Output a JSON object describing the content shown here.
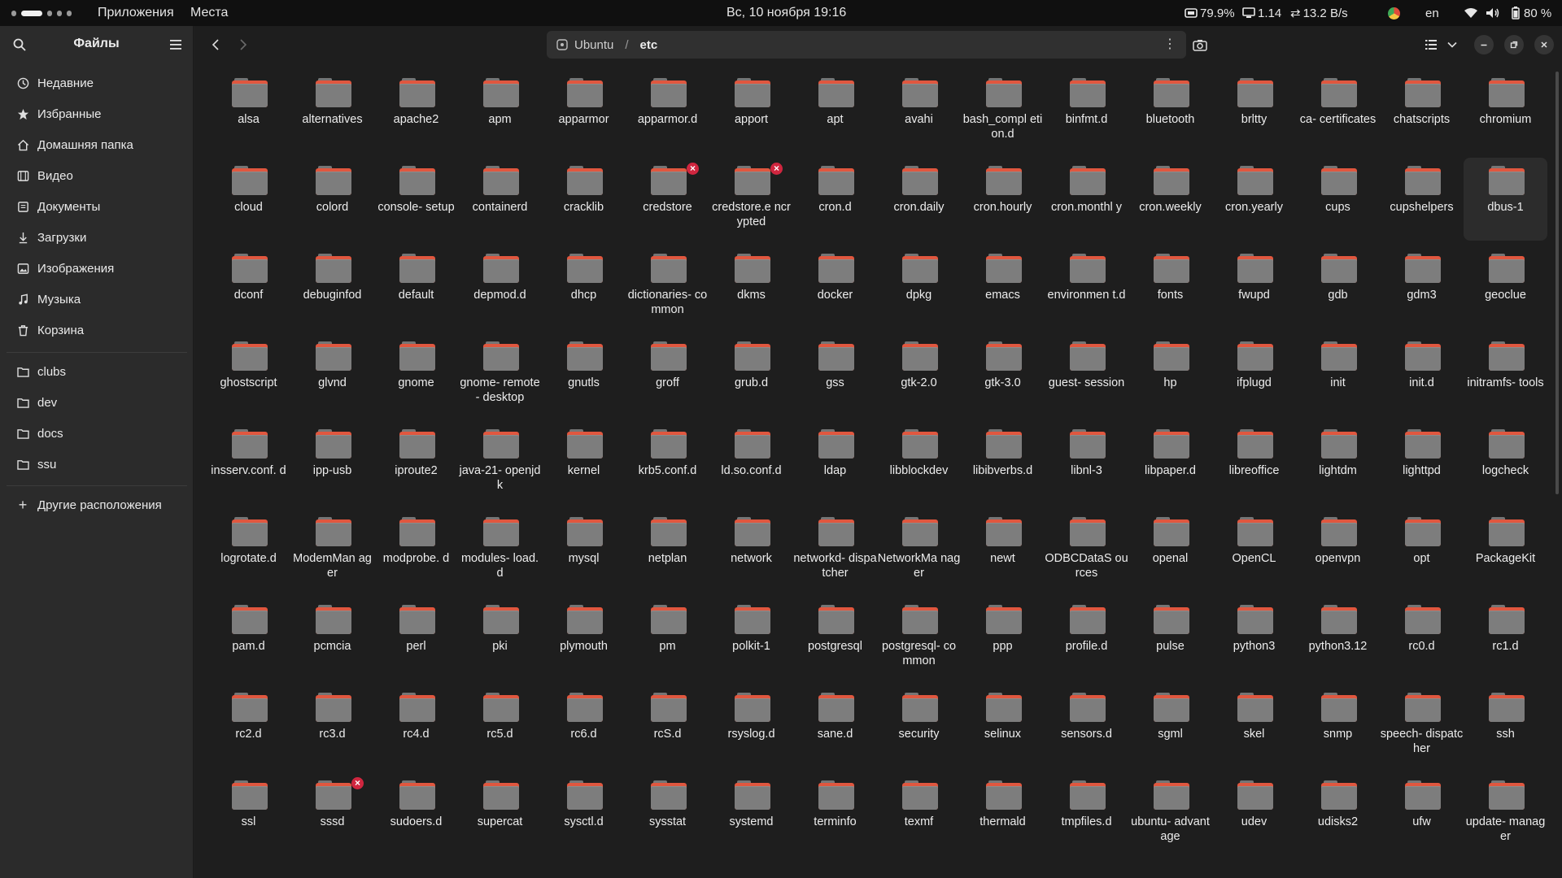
{
  "topbar": {
    "activities_dots": 4,
    "apps_label": "Приложения",
    "places_label": "Места",
    "clock": "Вс, 10 ноября 19:16",
    "cpu": "79.9%",
    "load": "1.14",
    "net": "13.2 B/s",
    "lang": "en",
    "battery": "80 %"
  },
  "sidebar": {
    "title": "Файлы",
    "places": [
      {
        "label": "Недавние",
        "icon": "clock-icon"
      },
      {
        "label": "Избранные",
        "icon": "star-icon"
      },
      {
        "label": "Домашняя папка",
        "icon": "home-icon"
      },
      {
        "label": "Видео",
        "icon": "video-icon"
      },
      {
        "label": "Документы",
        "icon": "document-icon"
      },
      {
        "label": "Загрузки",
        "icon": "download-icon"
      },
      {
        "label": "Изображения",
        "icon": "image-icon"
      },
      {
        "label": "Музыка",
        "icon": "music-icon"
      },
      {
        "label": "Корзина",
        "icon": "trash-icon"
      }
    ],
    "bookmarks": [
      {
        "label": "clubs",
        "icon": "folder-icon"
      },
      {
        "label": "dev",
        "icon": "folder-icon"
      },
      {
        "label": "docs",
        "icon": "folder-icon"
      },
      {
        "label": "ssu",
        "icon": "folder-icon"
      }
    ],
    "other_locations": "Другие расположения"
  },
  "pathbar": {
    "root": "Ubuntu",
    "separator": "/",
    "current": "etc"
  },
  "colors": {
    "folder_accent": "#e0573f",
    "folder_body": "#7d7d7d",
    "emblem": "#d0263f",
    "background": "#1e1e1e"
  },
  "files": [
    {
      "name": "alsa"
    },
    {
      "name": "alternatives"
    },
    {
      "name": "apache2"
    },
    {
      "name": "apm"
    },
    {
      "name": "apparmor"
    },
    {
      "name": "apparmor.d"
    },
    {
      "name": "apport"
    },
    {
      "name": "apt"
    },
    {
      "name": "avahi"
    },
    {
      "name": "bash_compl etion.d"
    },
    {
      "name": "binfmt.d"
    },
    {
      "name": "bluetooth"
    },
    {
      "name": "brltty"
    },
    {
      "name": "ca- certificates"
    },
    {
      "name": "chatscripts"
    },
    {
      "name": "chromium"
    },
    {
      "name": "cloud"
    },
    {
      "name": "colord"
    },
    {
      "name": "console- setup"
    },
    {
      "name": "containerd"
    },
    {
      "name": "cracklib"
    },
    {
      "name": "credstore",
      "locked": true
    },
    {
      "name": "credstore.e ncrypted",
      "locked": true
    },
    {
      "name": "cron.d"
    },
    {
      "name": "cron.daily"
    },
    {
      "name": "cron.hourly"
    },
    {
      "name": "cron.monthl y"
    },
    {
      "name": "cron.weekly"
    },
    {
      "name": "cron.yearly"
    },
    {
      "name": "cups"
    },
    {
      "name": "cupshelpers"
    },
    {
      "name": "dbus-1",
      "selected": true
    },
    {
      "name": "dconf"
    },
    {
      "name": "debuginfod"
    },
    {
      "name": "default"
    },
    {
      "name": "depmod.d"
    },
    {
      "name": "dhcp"
    },
    {
      "name": "dictionaries- common"
    },
    {
      "name": "dkms"
    },
    {
      "name": "docker"
    },
    {
      "name": "dpkg"
    },
    {
      "name": "emacs"
    },
    {
      "name": "environmen t.d"
    },
    {
      "name": "fonts"
    },
    {
      "name": "fwupd"
    },
    {
      "name": "gdb"
    },
    {
      "name": "gdm3"
    },
    {
      "name": "geoclue"
    },
    {
      "name": "ghostscript"
    },
    {
      "name": "glvnd"
    },
    {
      "name": "gnome"
    },
    {
      "name": "gnome- remote- desktop"
    },
    {
      "name": "gnutls"
    },
    {
      "name": "groff"
    },
    {
      "name": "grub.d"
    },
    {
      "name": "gss"
    },
    {
      "name": "gtk-2.0"
    },
    {
      "name": "gtk-3.0"
    },
    {
      "name": "guest- session"
    },
    {
      "name": "hp"
    },
    {
      "name": "ifplugd"
    },
    {
      "name": "init"
    },
    {
      "name": "init.d"
    },
    {
      "name": "initramfs- tools"
    },
    {
      "name": "insserv.conf. d"
    },
    {
      "name": "ipp-usb"
    },
    {
      "name": "iproute2"
    },
    {
      "name": "java-21- openjdk"
    },
    {
      "name": "kernel"
    },
    {
      "name": "krb5.conf.d"
    },
    {
      "name": "ld.so.conf.d"
    },
    {
      "name": "ldap"
    },
    {
      "name": "libblockdev"
    },
    {
      "name": "libibverbs.d"
    },
    {
      "name": "libnl-3"
    },
    {
      "name": "libpaper.d"
    },
    {
      "name": "libreoffice"
    },
    {
      "name": "lightdm"
    },
    {
      "name": "lighttpd"
    },
    {
      "name": "logcheck"
    },
    {
      "name": "logrotate.d"
    },
    {
      "name": "ModemMan ager"
    },
    {
      "name": "modprobe. d"
    },
    {
      "name": "modules- load.d"
    },
    {
      "name": "mysql"
    },
    {
      "name": "netplan"
    },
    {
      "name": "network"
    },
    {
      "name": "networkd- dispatcher"
    },
    {
      "name": "NetworkMa nager"
    },
    {
      "name": "newt"
    },
    {
      "name": "ODBCDataS ources"
    },
    {
      "name": "openal"
    },
    {
      "name": "OpenCL"
    },
    {
      "name": "openvpn"
    },
    {
      "name": "opt"
    },
    {
      "name": "PackageKit"
    },
    {
      "name": "pam.d"
    },
    {
      "name": "pcmcia"
    },
    {
      "name": "perl"
    },
    {
      "name": "pki"
    },
    {
      "name": "plymouth"
    },
    {
      "name": "pm"
    },
    {
      "name": "polkit-1"
    },
    {
      "name": "postgresql"
    },
    {
      "name": "postgresql- common"
    },
    {
      "name": "ppp"
    },
    {
      "name": "profile.d"
    },
    {
      "name": "pulse"
    },
    {
      "name": "python3"
    },
    {
      "name": "python3.12"
    },
    {
      "name": "rc0.d"
    },
    {
      "name": "rc1.d"
    },
    {
      "name": "rc2.d"
    },
    {
      "name": "rc3.d"
    },
    {
      "name": "rc4.d"
    },
    {
      "name": "rc5.d"
    },
    {
      "name": "rc6.d"
    },
    {
      "name": "rcS.d"
    },
    {
      "name": "rsyslog.d"
    },
    {
      "name": "sane.d"
    },
    {
      "name": "security"
    },
    {
      "name": "selinux"
    },
    {
      "name": "sensors.d"
    },
    {
      "name": "sgml"
    },
    {
      "name": "skel"
    },
    {
      "name": "snmp"
    },
    {
      "name": "speech- dispatcher"
    },
    {
      "name": "ssh"
    },
    {
      "name": "ssl"
    },
    {
      "name": "sssd",
      "locked": true
    },
    {
      "name": "sudoers.d"
    },
    {
      "name": "supercat"
    },
    {
      "name": "sysctl.d"
    },
    {
      "name": "sysstat"
    },
    {
      "name": "systemd"
    },
    {
      "name": "terminfo"
    },
    {
      "name": "texmf"
    },
    {
      "name": "thermald"
    },
    {
      "name": "tmpfiles.d"
    },
    {
      "name": "ubuntu- advantage"
    },
    {
      "name": "udev"
    },
    {
      "name": "udisks2"
    },
    {
      "name": "ufw"
    },
    {
      "name": "update- manager"
    }
  ]
}
